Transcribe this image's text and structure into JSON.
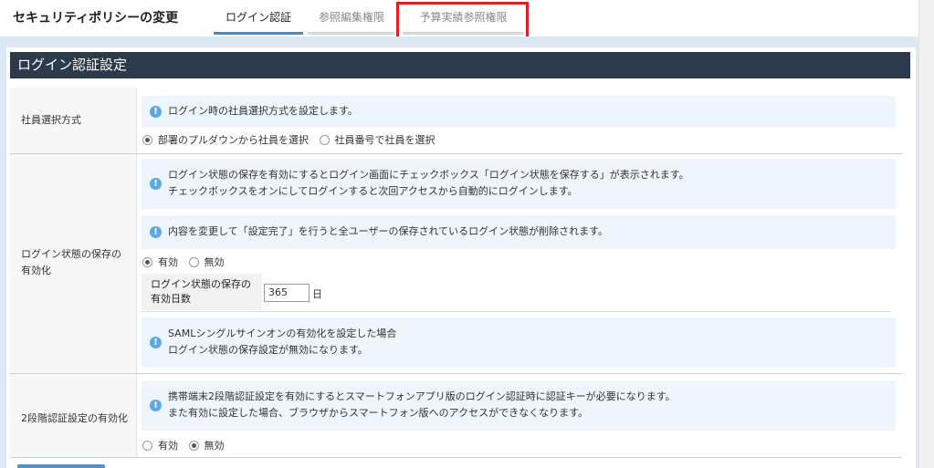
{
  "header": {
    "title": "セキュリティポリシーの変更",
    "tabs": [
      {
        "label": "ログイン認証",
        "active": true
      },
      {
        "label": "参照編集権限",
        "active": false
      },
      {
        "label": "予算実績参照権限",
        "active": false
      }
    ]
  },
  "section": {
    "title": "ログイン認証設定"
  },
  "employee_selection": {
    "label": "社員選択方式",
    "info": "ログイン時の社員選択方式を設定します。",
    "options": [
      "部署のプルダウンから社員を選択",
      "社員番号で社員を選択"
    ],
    "selected": "部署のプルダウンから社員を選択"
  },
  "login_state": {
    "label_line1": "ログイン状態の保存の",
    "label_line2": "有効化",
    "info1_line1": "ログイン状態の保存を有効にするとログイン画面にチェックボックス「ログイン状態を保存する」が表示されます。",
    "info1_line2": "チェックボックスをオンにしてログインすると次回アクセスから自動的にログインします。",
    "info2": "内容を変更して「設定完了」を行うと全ユーザーの保存されているログイン状態が削除されます。",
    "options": [
      "有効",
      "無効"
    ],
    "selected": "有効",
    "days_label_line1": "ログイン状態の保存の",
    "days_label_line2": "有効日数",
    "days_value": "365",
    "days_unit": "日",
    "info3_line1": "SAMLシングルサインオンの有効化を設定した場合",
    "info3_line2": "ログイン状態の保存設定が無効になります。"
  },
  "two_factor": {
    "label": "2段階認証設定の有効化",
    "info_line1": "携帯端末2段階認証設定を有効にするとスマートフォンアプリ版のログイン認証時に認証キーが必要になります。",
    "info_line2": "また有効に設定した場合、ブラウザからスマートフォン版へのアクセスができなくなります。",
    "options": [
      "有効",
      "無効"
    ],
    "selected": "無効"
  },
  "colors": {
    "header_bg": "#2c3a4c",
    "active_tab": "#3a8fd4",
    "highlight": "#e21e1e",
    "info_bg": "#eef5fc",
    "info_icon": "#5aa9e6"
  }
}
